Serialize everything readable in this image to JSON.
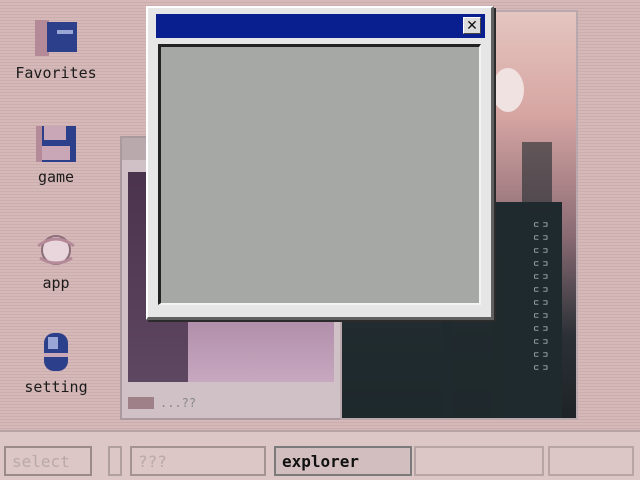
{
  "desktop_icons": [
    {
      "label": "Favorites",
      "icon": "folder-icon"
    },
    {
      "label": "game",
      "icon": "floppy-disk-icon"
    },
    {
      "label": "app",
      "icon": "app-icon"
    },
    {
      "label": "setting",
      "icon": "mouse-icon"
    }
  ],
  "background_window": {
    "status_text": "...??"
  },
  "dialog": {
    "close_label": "✕",
    "title_color": "#0a1f8f",
    "content_color": "#a5a8a5"
  },
  "taskbar": {
    "select_label": "select",
    "field_value": "???",
    "explorer_label": "explorer"
  }
}
